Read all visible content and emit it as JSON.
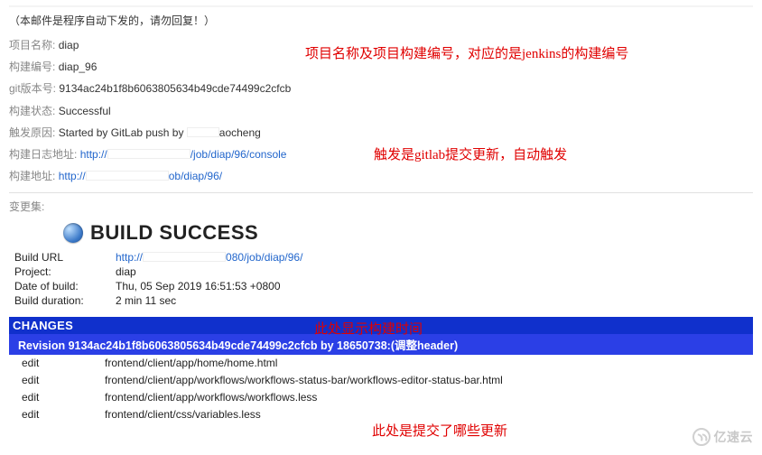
{
  "notice": "（本邮件是程序自动下发的，请勿回复！）",
  "fields": {
    "project_name_label": "项目名称:",
    "project_name": "diap",
    "build_no_label": "构建编号:",
    "build_no": "diap_96",
    "git_ver_label": "git版本号:",
    "git_ver": "9134ac24b1f8b6063805634b49cde74499c2cfcb",
    "status_label": "构建状态:",
    "status": "Successful",
    "cause_label": "触发原因:",
    "cause_pre": "Started by GitLab push by",
    "cause_post": "aocheng",
    "log_label": "构建日志地址:",
    "log_url_pre": "http://",
    "log_url_post": "/job/diap/96/console",
    "addr_label": "构建地址:",
    "addr_url_pre": "http://",
    "addr_url_post": "ob/diap/96/",
    "changes_label": "变更集:"
  },
  "success_title": "BUILD SUCCESS",
  "meta": {
    "build_url_k": "Build URL",
    "build_url_pre": "http://",
    "build_url_post": "080/job/diap/96/",
    "project_k": "Project:",
    "project_v": "diap",
    "date_k": "Date of build:",
    "date_v": "Thu, 05 Sep 2019 16:51:53 +0800",
    "dur_k": "Build duration:",
    "dur_v": "2 min 11 sec"
  },
  "changes_header": "CHANGES",
  "revision": {
    "prefix": "Revision ",
    "hash": "9134ac24b1f8b6063805634b49cde74499c2cfcb",
    "mid": " by ",
    "author": "18650738:",
    "msg": "(调整header)"
  },
  "changes": [
    {
      "action": "edit",
      "path": "frontend/client/app/home/home.html"
    },
    {
      "action": "edit",
      "path": "frontend/client/app/workflows/workflows-status-bar/workflows-editor-status-bar.html"
    },
    {
      "action": "edit",
      "path": "frontend/client/app/workflows/workflows.less"
    },
    {
      "action": "edit",
      "path": "frontend/client/css/variables.less"
    }
  ],
  "annotations": {
    "a1": "项目名称及项目构建编号，对应的是jenkins的构建编号",
    "a2": "触发是gitlab提交更新，自动触发",
    "a3": "此处显示构建时间",
    "a4": "此处是提交了哪些更新"
  },
  "watermark": "亿速云"
}
